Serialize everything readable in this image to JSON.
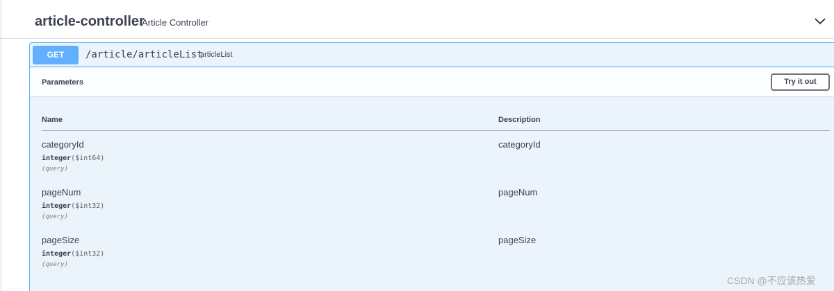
{
  "tag": {
    "title": "article-controller",
    "description": "Article Controller"
  },
  "operation": {
    "method": "GET",
    "path": "/article/articleList",
    "summary": "articleList",
    "method_color": "#61affe"
  },
  "parameters": {
    "section_title": "Parameters",
    "try_button_label": "Try it out",
    "col_name": "Name",
    "col_description": "Description",
    "items": [
      {
        "name": "categoryId",
        "type": "integer",
        "format": "($int64)",
        "in": "(query)",
        "description": "categoryId"
      },
      {
        "name": "pageNum",
        "type": "integer",
        "format": "($int32)",
        "in": "(query)",
        "description": "pageNum"
      },
      {
        "name": "pageSize",
        "type": "integer",
        "format": "($int32)",
        "in": "(query)",
        "description": "pageSize"
      }
    ]
  },
  "watermark": "CSDN @不应该热爱"
}
